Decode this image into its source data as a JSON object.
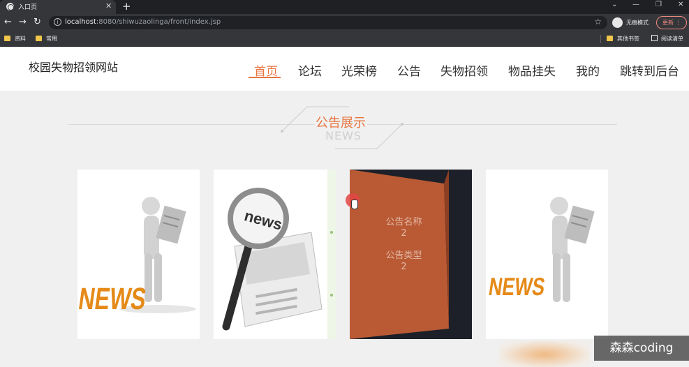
{
  "browser": {
    "tab_title": "入口页",
    "tab_close": "✕",
    "new_tab": "+",
    "url_host": "localhost",
    "url_rest": ":8080/shiwuzaolinga/front/index.jsp",
    "incognito_label": "无痕模式",
    "update_label": "更新",
    "bookmarks": [
      "资料",
      "常用"
    ],
    "other_bookmarks": "其他书签",
    "reading_list": "阅读清单",
    "controls": {
      "minimize": "—",
      "restore": "❐",
      "close": "✕",
      "dropdown": "⌄"
    }
  },
  "site": {
    "title": "校园失物招领网站",
    "nav": [
      "首页",
      "论坛",
      "光荣榜",
      "公告",
      "失物招领",
      "物品挂失",
      "我的",
      "跳转到后台"
    ],
    "active_nav_index": 0
  },
  "section": {
    "title": "公告展示",
    "subtitle": "NEWS"
  },
  "cards": [
    {
      "image": "news-figure-reading-newspaper",
      "text": "NEWS"
    },
    {
      "image": "magnifier-over-newspaper",
      "text": "news"
    },
    {
      "label1": "公告名称",
      "value1": "2",
      "label2": "公告类型",
      "value2": "2"
    },
    {
      "image": "news-figure-reading-newspaper",
      "text": "NEWS"
    }
  ],
  "watermark": "森森coding",
  "colors": {
    "accent": "#e9743f",
    "notice_panel": "#b95a35",
    "chrome": "#35363a"
  }
}
